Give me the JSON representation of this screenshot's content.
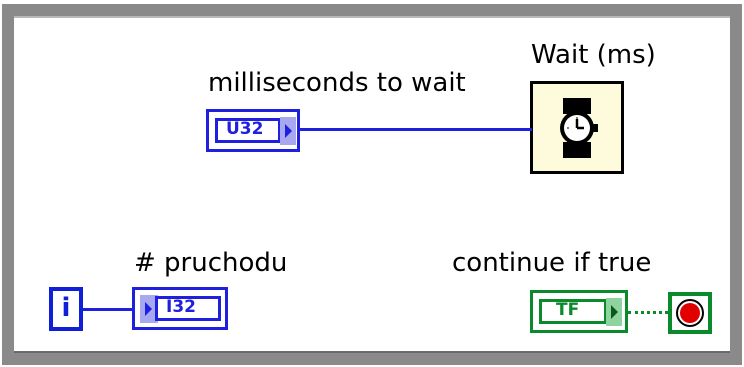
{
  "diagram": {
    "wait_node": {
      "title": "Wait (ms)",
      "icon": "wristwatch-icon"
    },
    "control_ms": {
      "label": "milliseconds to wait",
      "type": "U32",
      "color": "#1f1fe0"
    },
    "indicator_iterations": {
      "label": "# pruchodu",
      "type": "I32",
      "color": "#1f1fe0"
    },
    "iteration_terminal": {
      "symbol": "i",
      "color": "#1020d8"
    },
    "control_condition": {
      "label": "continue if true",
      "type": "TF",
      "color": "#0a8a2a"
    },
    "loop_condition": {
      "icon": "stop-sign-icon",
      "color": "#e00000"
    },
    "frame_color": "#8a8a8a"
  }
}
